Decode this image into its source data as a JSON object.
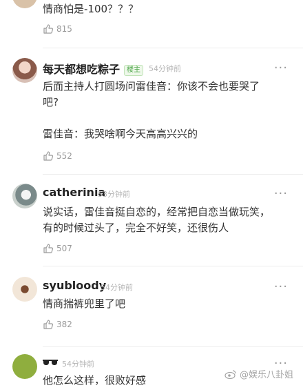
{
  "comments": [
    {
      "text": "情商怕是-100？？？",
      "likes": "815"
    },
    {
      "username": "每天都想吃粽子",
      "badge": "楼主",
      "time": "54分钟前",
      "more": "···",
      "text_line1": "后面主持人打圆场问雷佳音：你该不会也要哭了",
      "text_line2": "吧?",
      "text_line3": "雷佳音：我哭啥啊今天高高兴兴的",
      "likes": "552"
    },
    {
      "username": "catherinia",
      "time": "53分钟前",
      "more": "···",
      "text_line1": "说实话，雷佳音挺自恋的，经常把自恋当做玩笑，",
      "text_line2": "有的时候过头了，完全不好笑，还很伤人",
      "likes": "507"
    },
    {
      "username": "syubloody",
      "time": "54分钟前",
      "more": "···",
      "text": "情商揣裤兜里了吧",
      "likes": "382"
    },
    {
      "time": "54分钟前",
      "more": "···",
      "text": "他怎么这样，很败好感"
    }
  ],
  "watermark": "@娱乐八卦姐",
  "icons": {
    "like": "thumbs-up-icon",
    "sunglasses": "sunglasses-emoji-icon",
    "weibo": "weibo-logo-icon"
  },
  "colors": {
    "badge_green": "#52a84e",
    "time_gray": "#b5b5b5",
    "name": "#222222",
    "text": "#333333"
  }
}
